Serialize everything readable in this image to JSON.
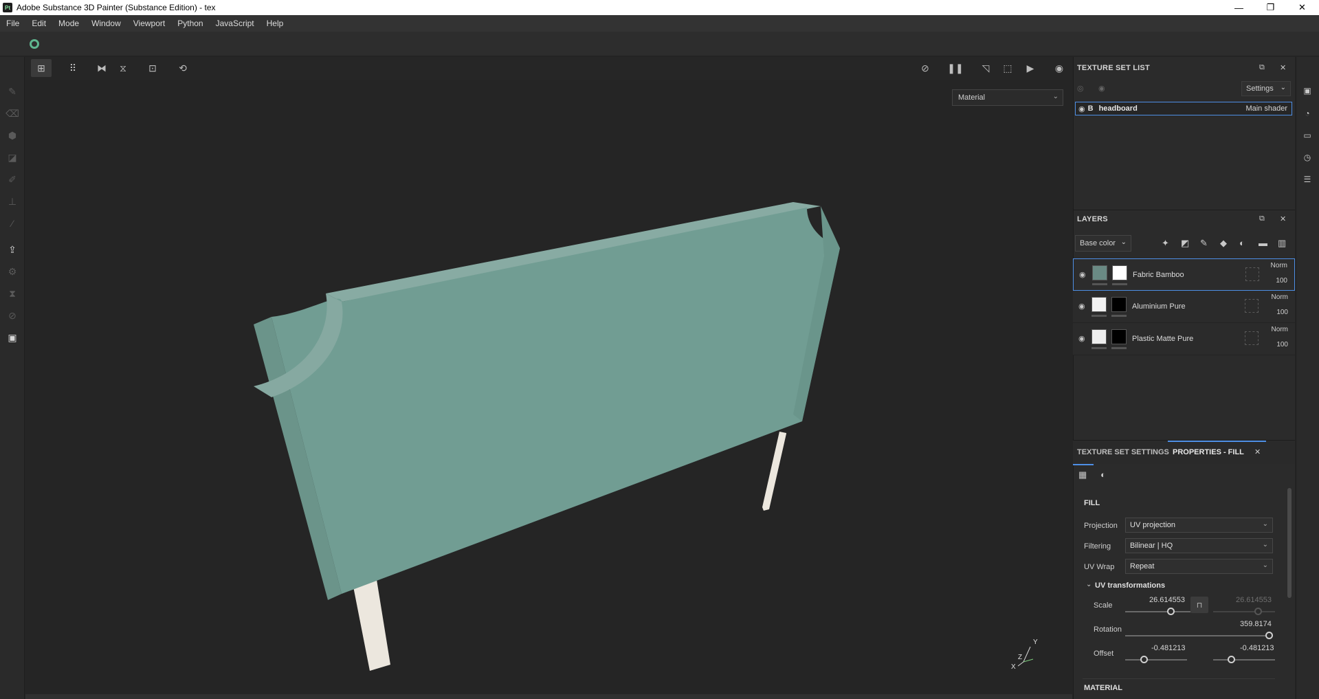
{
  "window": {
    "title": "Adobe Substance 3D Painter (Substance Edition) - tex",
    "logo_text": "Pt",
    "controls": [
      "—",
      "❐",
      "✕"
    ]
  },
  "menubar": [
    "File",
    "Edit",
    "Mode",
    "Window",
    "Viewport",
    "Python",
    "JavaScript",
    "Help"
  ],
  "viewport": {
    "display_mode": "Material",
    "mesh_colors": {
      "fabric": "#6f9a90",
      "legs": "#ece7de"
    },
    "axis_labels": {
      "y": "Y",
      "z": "Z",
      "x": "X"
    }
  },
  "texture_set_list": {
    "title": "TEXTURE SET LIST",
    "settings_label": "Settings",
    "row": {
      "tag": "B",
      "name": "headboard",
      "shader": "Main shader"
    }
  },
  "layers": {
    "title": "LAYERS",
    "channel": "Base color",
    "items": [
      {
        "name": "Fabric Bamboo",
        "blend": "Norm",
        "opacity": "100",
        "thumb_color": "#6a8a84",
        "mask_color": "#ffffff",
        "selected": true
      },
      {
        "name": "Aluminium Pure",
        "blend": "Norm",
        "opacity": "100",
        "thumb_color": "#f2f2f2",
        "mask_color": "#000000",
        "selected": false
      },
      {
        "name": "Plastic Matte Pure",
        "blend": "Norm",
        "opacity": "100",
        "thumb_color": "#eeeeee",
        "mask_color": "#000000",
        "selected": false
      }
    ]
  },
  "properties": {
    "tab_texture_settings": "TEXTURE SET SETTINGS",
    "tab_fill": "PROPERTIES - FILL",
    "section_fill": "FILL",
    "projection": {
      "label": "Projection",
      "value": "UV projection"
    },
    "filtering": {
      "label": "Filtering",
      "value": "Bilinear | HQ"
    },
    "uv_wrap": {
      "label": "UV Wrap",
      "value": "Repeat"
    },
    "uv_transformations": "UV transformations",
    "scale": {
      "label": "Scale",
      "value_u": "26.614553",
      "value_v": "26.614553"
    },
    "rotation": {
      "label": "Rotation",
      "value": "359.8174"
    },
    "offset": {
      "label": "Offset",
      "value_u": "-0.481213",
      "value_v": "-0.481213"
    },
    "section_material": "MATERIAL"
  },
  "colors": {
    "accent": "#4e8fe6",
    "substance_green": "#5fb58f"
  }
}
